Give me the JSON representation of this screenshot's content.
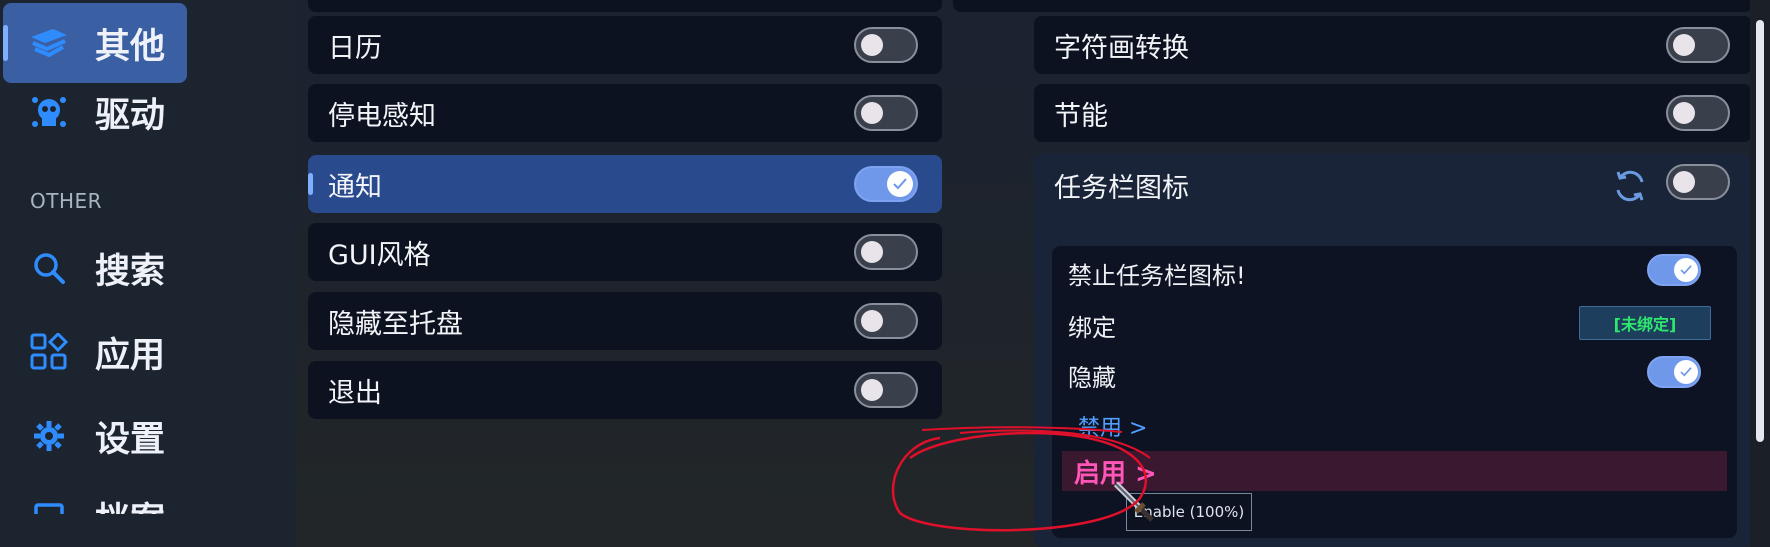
{
  "sidebar": {
    "items": [
      {
        "label": "其他",
        "icon": "layers-icon",
        "active": true
      },
      {
        "label": "驱动",
        "icon": "skull-icon",
        "active": false
      },
      {
        "label": "搜索",
        "icon": "search-icon",
        "active": false
      },
      {
        "label": "应用",
        "icon": "apps-grid-icon",
        "active": false
      },
      {
        "label": "设置",
        "icon": "gear-icon",
        "active": false
      },
      {
        "label": "档案",
        "icon": "document-icon",
        "active": false
      }
    ],
    "section_label": "OTHER"
  },
  "left_column": [
    {
      "label": "日历",
      "enabled": false
    },
    {
      "label": "停电感知",
      "enabled": false
    },
    {
      "label": "通知",
      "enabled": true,
      "selected": true
    },
    {
      "label": "GUI风格",
      "enabled": false
    },
    {
      "label": "隐藏至托盘",
      "enabled": false
    },
    {
      "label": "退出",
      "enabled": false
    }
  ],
  "right_column": [
    {
      "label": "字符画转换",
      "enabled": false
    },
    {
      "label": "节能",
      "enabled": false
    }
  ],
  "taskbar_panel": {
    "title": "任务栏图标",
    "enabled": false,
    "refresh_icon": "refresh-icon",
    "rows": {
      "disable_label": "禁止任务栏图标!",
      "disable_enabled": true,
      "bind_label": "绑定",
      "bind_value": "[未绑定]",
      "hide_label": "隐藏",
      "hide_enabled": true,
      "disabled_link": "禁用 >",
      "enabled_link": "启用 >",
      "tooltip": "Enable (100%)"
    }
  },
  "colors": {
    "accent": "#3b5fa3",
    "toggle_on": "#6f97ea",
    "enable_pink": "#ff56b8",
    "bind_green": "#2ee86e",
    "annotation_red": "#e0102a"
  }
}
